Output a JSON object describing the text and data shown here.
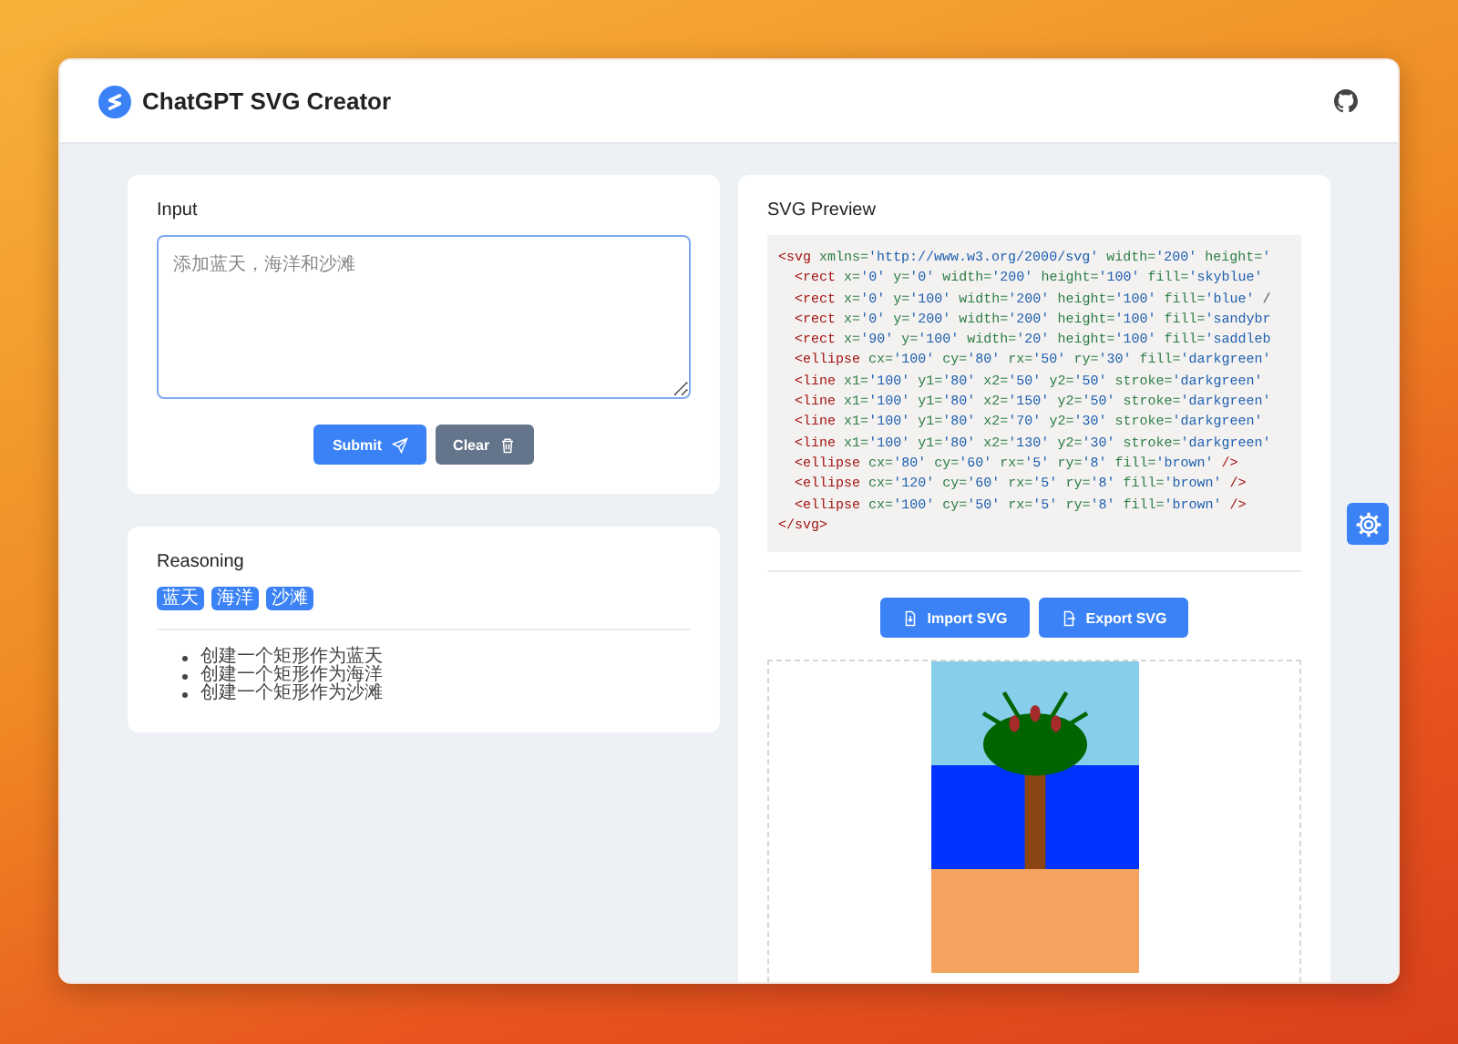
{
  "app": {
    "title": "ChatGPT SVG Creator"
  },
  "input": {
    "title": "Input",
    "placeholder": "添加蓝天，海洋和沙滩",
    "buttons": [
      {
        "label": "Submit",
        "kind": "primary"
      },
      {
        "label": "Clear",
        "kind": "secondary"
      }
    ]
  },
  "reasoning": {
    "title": "Reasoning",
    "tags": [
      "蓝天",
      "海洋",
      "沙滩"
    ],
    "steps": [
      "创建一个矩形作为蓝天",
      "创建一个矩形作为海洋",
      "创建一个矩形作为沙滩"
    ]
  },
  "preview": {
    "title": "SVG Preview",
    "code_lines": [
      "<svg xmlns='http://www.w3.org/2000/svg' width='200' height='",
      "  <rect x='0' y='0' width='200' height='100' fill='skyblue'",
      "  <rect x='0' y='100' width='200' height='100' fill='blue' /",
      "  <rect x='0' y='200' width='200' height='100' fill='sandybr",
      "  <rect x='90' y='100' width='20' height='100' fill='saddleb",
      "  <ellipse cx='100' cy='80' rx='50' ry='30' fill='darkgreen'",
      "  <line x1='100' y1='80' x2='50' y2='50' stroke='darkgreen'",
      "  <line x1='100' y1='80' x2='150' y2='50' stroke='darkgreen'",
      "  <line x1='100' y1='80' x2='70' y2='30' stroke='darkgreen'",
      "  <line x1='100' y1='80' x2='130' y2='30' stroke='darkgreen'",
      "  <ellipse cx='80' cy='60' rx='5' ry='8' fill='brown' />",
      "  <ellipse cx='120' cy='60' rx='5' ry='8' fill='brown' />",
      "  <ellipse cx='100' cy='50' rx='5' ry='8' fill='brown' />",
      "</svg>"
    ],
    "buttons": [
      {
        "label": "Import SVG",
        "kind": "import"
      },
      {
        "label": "Export SVG",
        "kind": "export"
      }
    ]
  }
}
